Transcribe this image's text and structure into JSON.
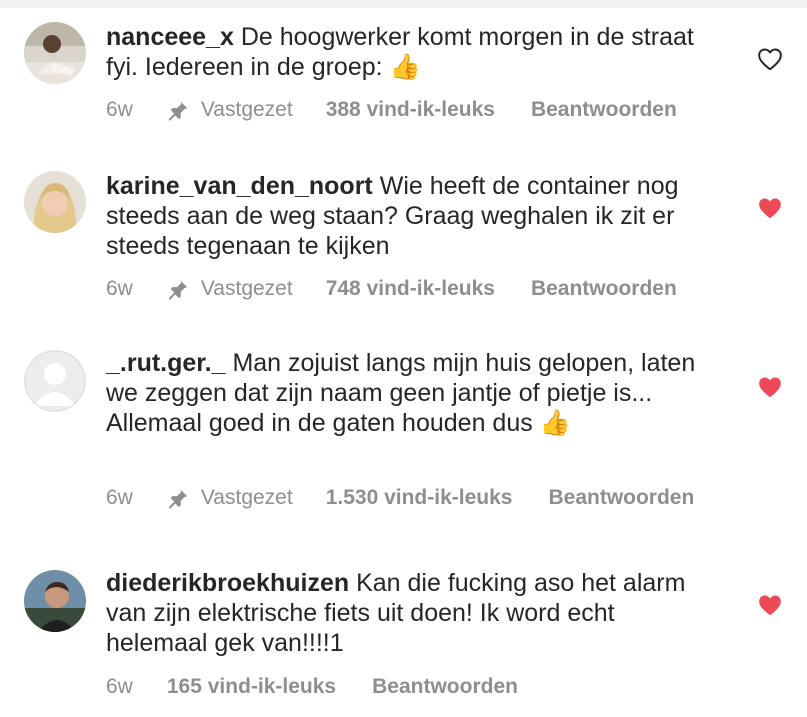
{
  "colors": {
    "text": "#262626",
    "meta": "#8e8e8e",
    "heart_liked": "#ed4956",
    "heart_outline": "#262626"
  },
  "comments": [
    {
      "username": "nanceee_x",
      "text": "De hoogwerker komt morgen in de straat fyi. Iedereen in de groep:",
      "emoji": "👍",
      "time": "6w",
      "pinned_label": "Vastgezet",
      "likes": "388 vind-ik-leuks",
      "reply_label": "Beantwoorden",
      "liked": false,
      "heart_icon": "heart-outline-icon"
    },
    {
      "username": "karine_van_den_noort",
      "text": "Wie heeft de container nog steeds aan de weg staan? Graag weghalen ik zit er steeds tegenaan te kijken",
      "emoji": "",
      "time": "6w",
      "pinned_label": "Vastgezet",
      "likes": "748 vind-ik-leuks",
      "reply_label": "Beantwoorden",
      "liked": true,
      "heart_icon": "heart-filled-icon"
    },
    {
      "username": "_.rut.ger._",
      "text": "Man zojuist langs mijn huis gelopen, laten we zeggen dat zijn naam geen jantje of pietje is... Allemaal goed in de gaten houden dus",
      "emoji": "👍",
      "time": "6w",
      "pinned_label": "Vastgezet",
      "likes": "1.530 vind-ik-leuks",
      "reply_label": "Beantwoorden",
      "liked": true,
      "heart_icon": "heart-filled-icon"
    },
    {
      "username": "diederikbroekhuizen",
      "text": "Kan die fucking aso het alarm van zijn elektrische fiets uit doen! Ik word echt helemaal gek van!!!!1",
      "emoji": "",
      "time": "6w",
      "likes": "165 vind-ik-leuks",
      "reply_label": "Beantwoorden",
      "liked": true,
      "heart_icon": "heart-filled-icon"
    }
  ]
}
